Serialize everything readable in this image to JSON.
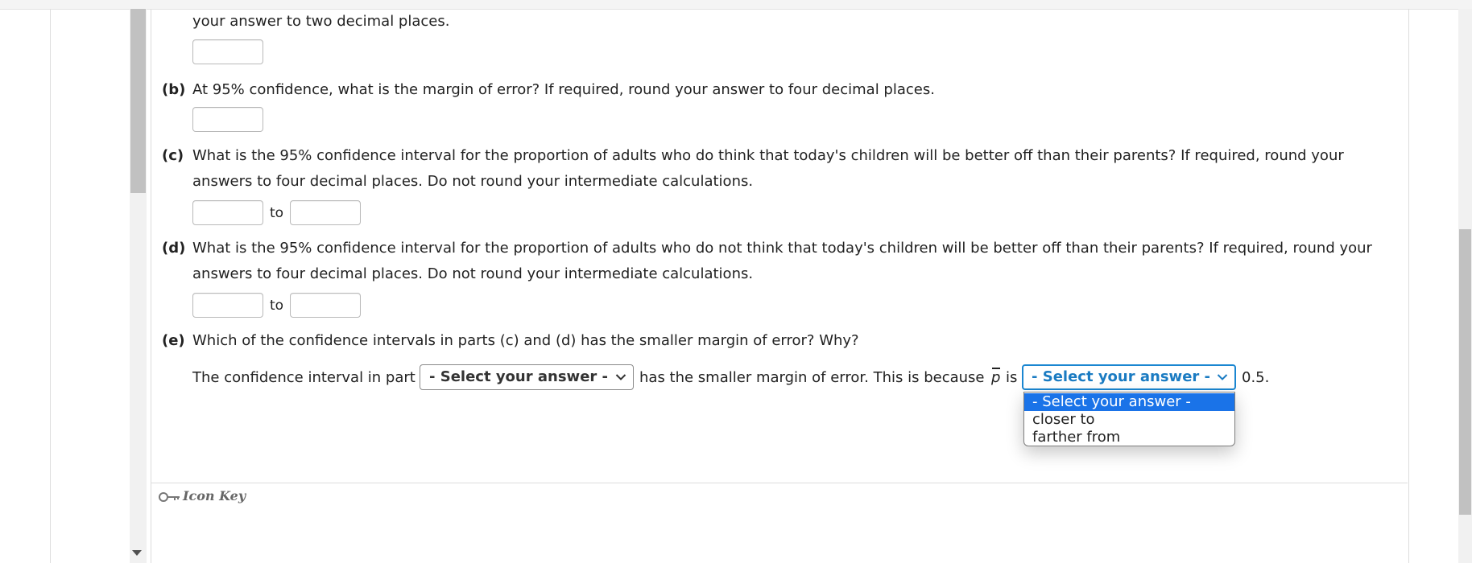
{
  "question": {
    "a_tail": "your answer to two decimal places.",
    "b": {
      "label": "(b)",
      "text": "At 95% confidence, what is the margin of error? If required, round your answer to four decimal places."
    },
    "c": {
      "label": "(c)",
      "line1": "What is the 95% confidence interval for the proportion of adults who do think that today's children will be better off than their parents? If required, round your",
      "line2": "answers to four decimal places. Do not round your intermediate calculations.",
      "to": "to"
    },
    "d": {
      "label": "(d)",
      "line1": "What is the 95% confidence interval for the proportion of adults who do not think that today's children will be better off than their parents? If required, round your",
      "line2": "answers to four decimal places. Do not round your intermediate calculations.",
      "to": "to"
    },
    "e": {
      "label": "(e)",
      "text": "Which of the confidence intervals in parts (c) and (d) has the smaller margin of error? Why?",
      "sentence_start": "The confidence interval in part",
      "select1": "- Select your answer -",
      "sentence_mid": "has the smaller margin of error. This is because",
      "p_symbol": "p",
      "is_word": "is",
      "select2": "- Select your answer -",
      "sentence_end": "0.5."
    }
  },
  "dropdown": {
    "options": [
      "- Select your answer -",
      "closer to",
      "farther from"
    ],
    "selected_index": 0
  },
  "footer": {
    "icon_key": "Icon Key"
  },
  "colors": {
    "accent": "#1a86d1",
    "option_highlight": "#1a73e8"
  }
}
